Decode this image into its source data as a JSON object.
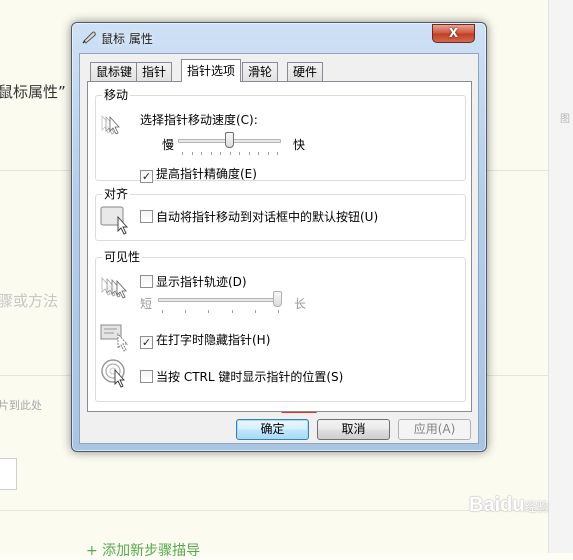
{
  "background": {
    "text_mouse_props": "鼠标属性”",
    "text_steps": "骤或方法",
    "text_upload": "片到此处",
    "text_add_step": "+ 添加新步骤描导",
    "watermark_main": "Baidu",
    "watermark_sub": "经验"
  },
  "dialog": {
    "title": "鼠标 属性",
    "close_label": "X",
    "tabs": [
      {
        "label": "鼠标键"
      },
      {
        "label": "指针"
      },
      {
        "label": "指针选项",
        "active": true
      },
      {
        "label": "滑轮"
      },
      {
        "label": "硬件"
      }
    ],
    "motion": {
      "group_label": "移动",
      "speed_label": "选择指针移动速度(C):",
      "slow_label": "慢",
      "fast_label": "快",
      "speed_level": 0.5,
      "precision_label": "提高指针精确度(E)",
      "precision_checked": true
    },
    "snap": {
      "group_label": "对齐",
      "snap_label": "自动将指针移动到对话框中的默认按钮(U)",
      "snap_checked": false
    },
    "visibility": {
      "group_label": "可见性",
      "trails_label": "显示指针轨迹(D)",
      "trails_checked": false,
      "short_label": "短",
      "long_label": "长",
      "trail_level": 1.0,
      "hide_label": "在打字时隐藏指针(H)",
      "hide_checked": true,
      "ctrl_label": "当按 CTRL 键时显示指针的位置(S)",
      "ctrl_checked": false
    },
    "buttons": {
      "ok": "确定",
      "cancel": "取消",
      "apply": "应用(A)"
    }
  },
  "colors": {
    "annotation_arrow": "#e8312a",
    "titlebar": "#b6cde9",
    "close_button": "#c13d25"
  }
}
